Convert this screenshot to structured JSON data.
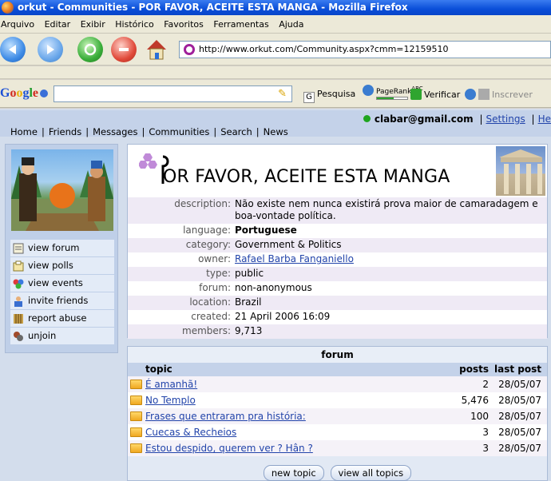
{
  "window": {
    "title": "orkut - Communities - POR FAVOR, ACEITE ESTA MANGA - Mozilla Firefox"
  },
  "menu": [
    "Arquivo",
    "Editar",
    "Exibir",
    "Histórico",
    "Favoritos",
    "Ferramentas",
    "Ajuda"
  ],
  "address": {
    "url": "http://www.orkut.com/Community.aspx?cmm=12159510"
  },
  "google_toolbar": {
    "search_value": "",
    "search_label": "Pesquisa",
    "pagerank_label": "PageRank",
    "pagerank_abc": "ABC",
    "pagerank_fill": 0.55,
    "check_label": "Verificar",
    "subscribe_label": "Inscrever"
  },
  "nav": {
    "links": [
      "Home",
      "Friends",
      "Messages",
      "Communities",
      "Search",
      "News"
    ],
    "user_email": "clabar@gmail.com",
    "settings": "Settings",
    "help": "He"
  },
  "sidebar": {
    "items": [
      {
        "label": "view forum",
        "icon": "forum-icon"
      },
      {
        "label": "view polls",
        "icon": "polls-icon"
      },
      {
        "label": "view events",
        "icon": "events-icon"
      },
      {
        "label": "invite friends",
        "icon": "invite-icon"
      },
      {
        "label": "report abuse",
        "icon": "report-icon"
      },
      {
        "label": "unjoin",
        "icon": "unjoin-icon"
      }
    ]
  },
  "community": {
    "title": "OR FAVOR, ACEITE ESTA MANGA",
    "fields": [
      {
        "label": "description:",
        "value": "Não existe nem nunca existirá prova maior de camaradagem e boa-vontade política."
      },
      {
        "label": "language:",
        "value": "Portuguese"
      },
      {
        "label": "category:",
        "value": "Government & Politics"
      },
      {
        "label": "owner:",
        "value": "Rafael Barba Fanganiello"
      },
      {
        "label": "type:",
        "value": "public"
      },
      {
        "label": "forum:",
        "value": "non-anonymous"
      },
      {
        "label": "location:",
        "value": "Brazil"
      },
      {
        "label": "created:",
        "value": "21 April 2006 16:09"
      },
      {
        "label": "members:",
        "value": "9,713"
      }
    ]
  },
  "forum": {
    "title": "forum",
    "columns": {
      "topic": "topic",
      "posts": "posts",
      "last": "last post"
    },
    "rows": [
      {
        "topic": "É amanhã!",
        "posts": "2",
        "last": "28/05/07"
      },
      {
        "topic": "No Templo",
        "posts": "5,476",
        "last": "28/05/07"
      },
      {
        "topic": "Frases que entraram pra história:",
        "posts": "100",
        "last": "28/05/07"
      },
      {
        "topic": "Cuecas & Recheios",
        "posts": "3",
        "last": "28/05/07"
      },
      {
        "topic": "Estou despido, querem ver ? Hân ?",
        "posts": "3",
        "last": "28/05/07"
      }
    ],
    "buttons": {
      "new_topic": "new topic",
      "view_all": "view all topics"
    }
  }
}
